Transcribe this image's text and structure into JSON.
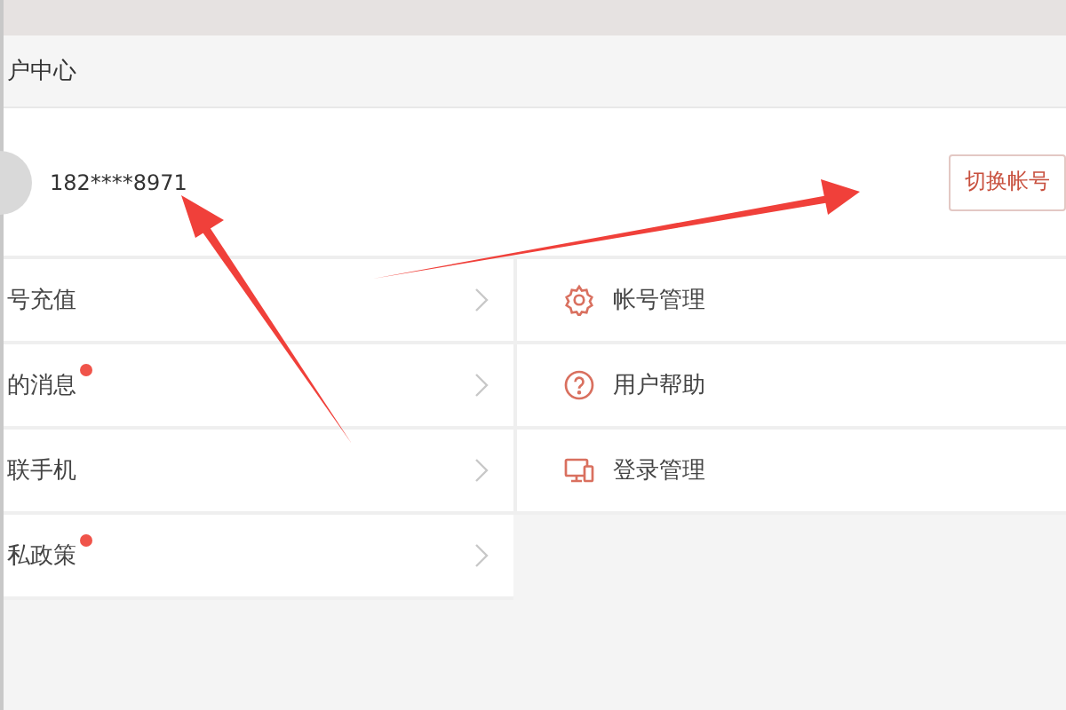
{
  "header": {
    "title": "户中心"
  },
  "profile": {
    "phone": "182****8971",
    "switch_button": "切换帐号"
  },
  "left_menu": [
    {
      "label": "号充值",
      "badge": false
    },
    {
      "label": "的消息",
      "badge": true
    },
    {
      "label": "联手机",
      "badge": false
    },
    {
      "label": "私政策",
      "badge": true
    }
  ],
  "right_menu": [
    {
      "label": "帐号管理",
      "kind": "gear"
    },
    {
      "label": "用户帮助",
      "kind": "help"
    },
    {
      "label": "登录管理",
      "kind": "devices"
    }
  ]
}
